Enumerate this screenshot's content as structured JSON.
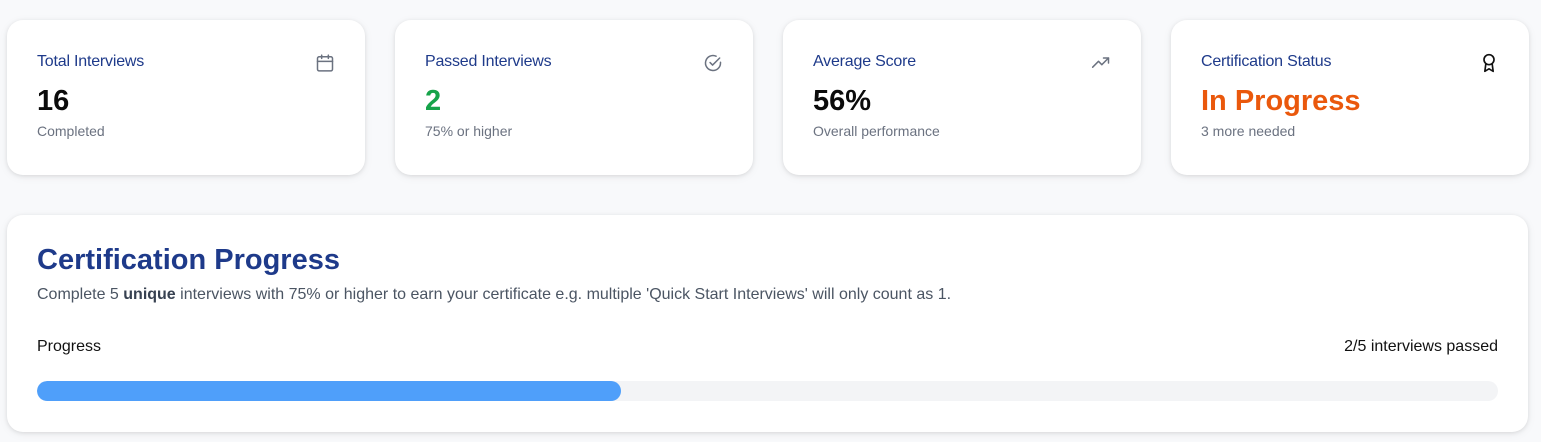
{
  "stats": [
    {
      "title": "Total Interviews",
      "value": "16",
      "sub": "Completed",
      "icon": "calendar-icon"
    },
    {
      "title": "Passed Interviews",
      "value": "2",
      "sub": "75% or higher",
      "icon": "check-circle-icon"
    },
    {
      "title": "Average Score",
      "value": "56%",
      "sub": "Overall performance",
      "icon": "trending-up-icon"
    },
    {
      "title": "Certification Status",
      "value": "In Progress",
      "sub": "3 more needed",
      "icon": "award-icon"
    }
  ],
  "colors": {
    "title_blue": "#1e3a8a",
    "pass_green": "#16a34a",
    "status_orange": "#ea580c",
    "progress_fill": "#4f9ffa",
    "progress_track": "#f3f4f6"
  },
  "progress": {
    "title": "Certification Progress",
    "desc_before": "Complete 5 ",
    "desc_bold": "unique",
    "desc_after": " interviews with 75% or higher to earn your certificate e.g. multiple 'Quick Start Interviews' will only count as 1.",
    "label": "Progress",
    "count_text": "2/5 interviews passed",
    "fraction": 0.4
  }
}
